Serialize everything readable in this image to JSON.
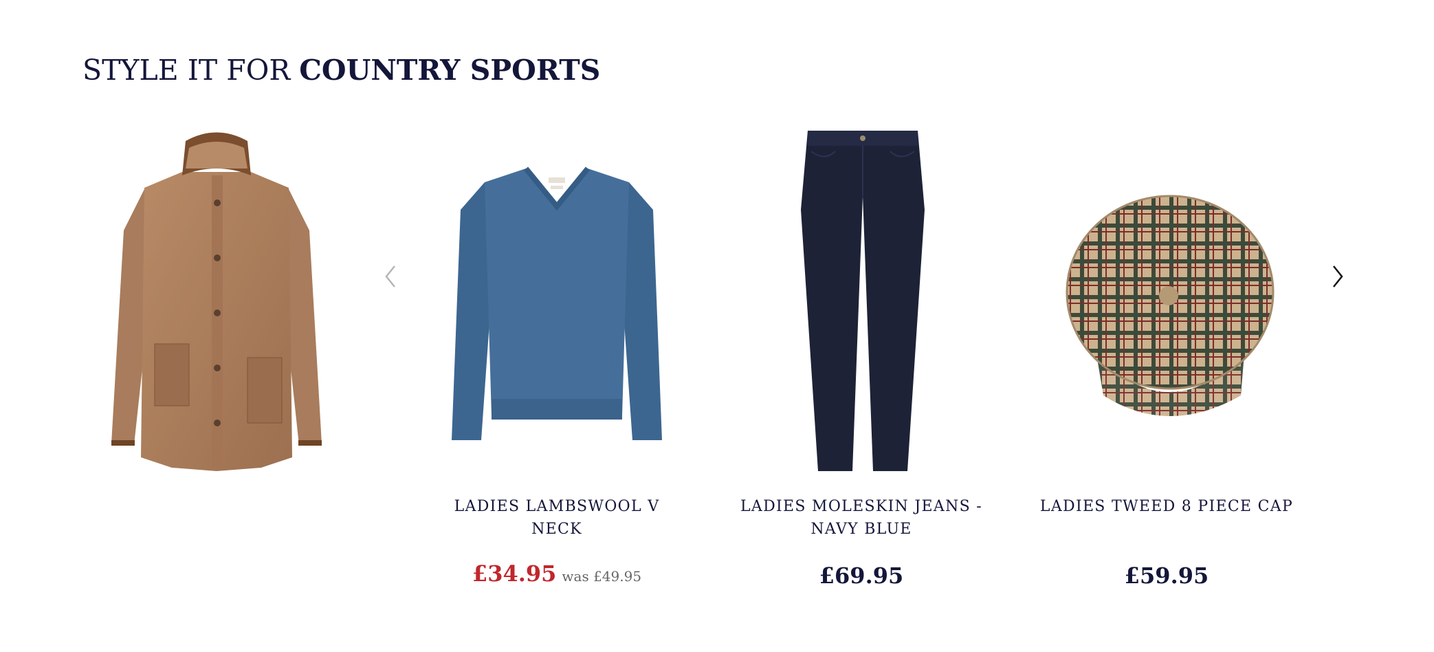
{
  "section": {
    "title_prefix": "STYLE IT FOR",
    "title_emphasis": "COUNTRY SPORTS"
  },
  "carousel": {
    "prev_icon": "chevron-left-icon",
    "next_icon": "chevron-right-icon",
    "products": [
      {
        "image": "jacket-image",
        "name": "",
        "price": "",
        "was": ""
      },
      {
        "image": "sweater-image",
        "name": "LADIES LAMBSWOOL V NECK",
        "price": "£34.95",
        "was": "was £49.95"
      },
      {
        "image": "jeans-image",
        "name": "LADIES MOLESKIN JEANS - NAVY BLUE",
        "price": "£69.95",
        "was": ""
      },
      {
        "image": "cap-image",
        "name": "LADIES TWEED 8 PIECE CAP",
        "price": "£59.95",
        "was": ""
      }
    ]
  },
  "colors": {
    "navy_text": "#14163a",
    "sale_red": "#c0272d",
    "muted_grey": "#666666"
  }
}
